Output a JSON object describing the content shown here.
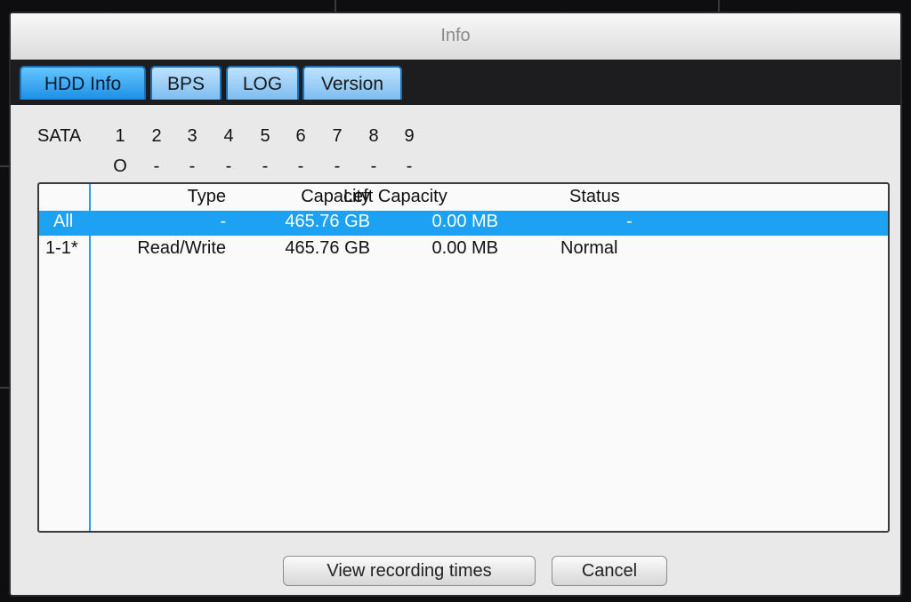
{
  "window": {
    "title": "Info"
  },
  "tabs": [
    {
      "label": "HDD Info",
      "active": true
    },
    {
      "label": "BPS",
      "active": false
    },
    {
      "label": "LOG",
      "active": false
    },
    {
      "label": "Version",
      "active": false
    }
  ],
  "sata": {
    "label": "SATA",
    "numbers": [
      "1",
      "2",
      "3",
      "4",
      "5",
      "6",
      "7",
      "8",
      "9"
    ],
    "states": [
      "O",
      "-",
      "-",
      "-",
      "-",
      "-",
      "-",
      "-",
      "-"
    ]
  },
  "table": {
    "headers": {
      "type": "Type",
      "capacity": "Capacity",
      "left_capacity": "Left Capacity",
      "status": "Status"
    },
    "rows": [
      {
        "id": "All",
        "type": "-",
        "capacity": "465.76 GB",
        "left_capacity": "0.00 MB",
        "status": "-"
      },
      {
        "id": "1-1*",
        "type": "Read/Write",
        "capacity": "465.76 GB",
        "left_capacity": "0.00 MB",
        "status": "Normal"
      }
    ]
  },
  "buttons": {
    "view_recording": "View recording times",
    "cancel": "Cancel"
  },
  "colors": {
    "selected_row": "#1da1f2",
    "active_tab": "#1d8fe6",
    "tab": "#7cbdf0",
    "accent_line": "#2b9fe6"
  }
}
